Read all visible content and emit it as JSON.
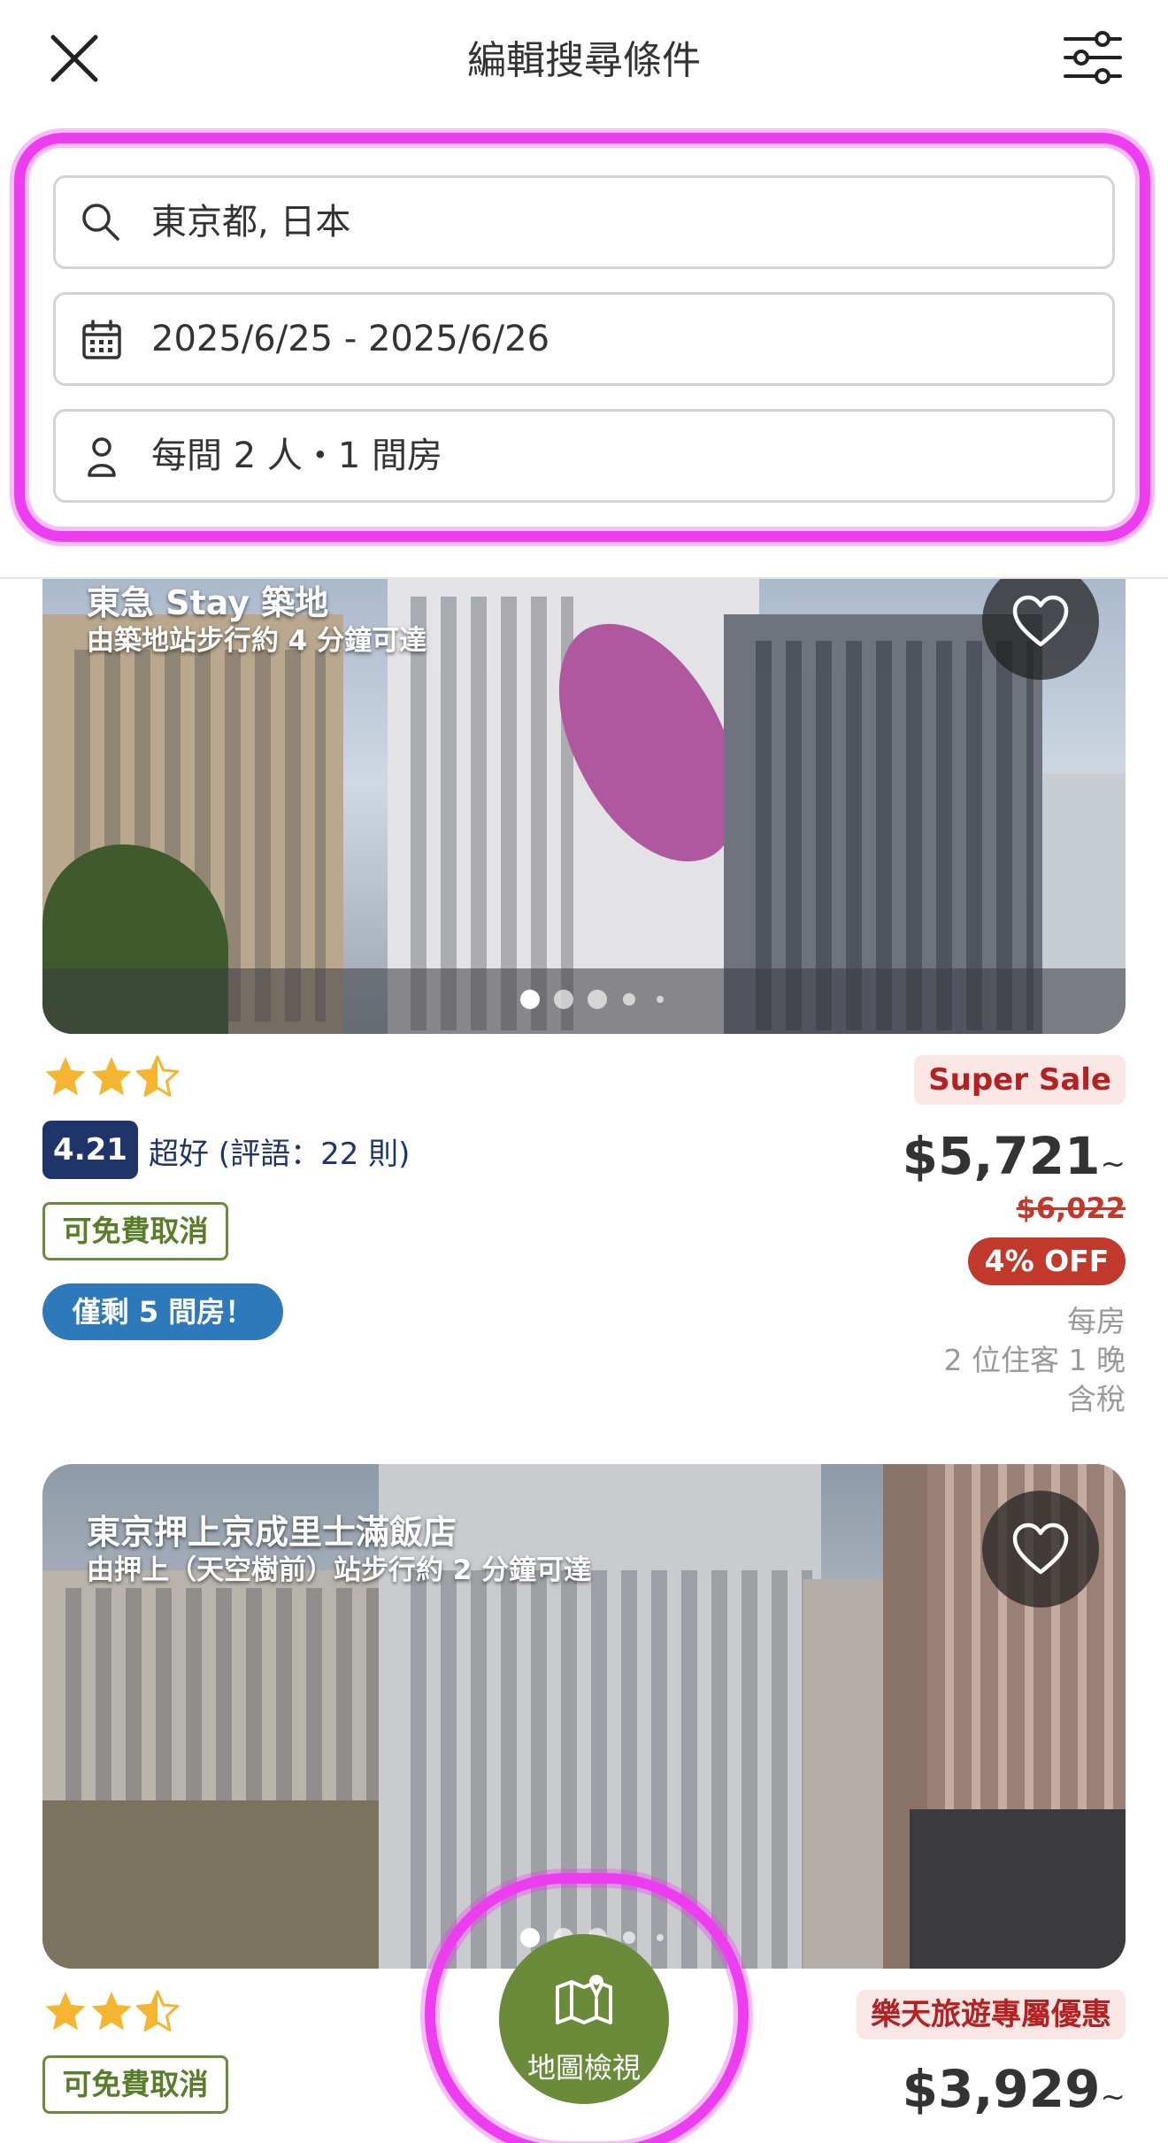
{
  "header": {
    "title": "編輯搜尋條件",
    "close_icon": "close-icon",
    "filter_icon": "sliders-icon"
  },
  "search": {
    "destination": "東京都, 日本",
    "dates": "2025/6/25 - 2025/6/26",
    "guests": "每間 2 人・1 間房"
  },
  "colors": {
    "highlight": "#ee3cf0",
    "rating_badge": "#1f3468",
    "cancel_green": "#6a8c3a",
    "rooms_blue": "#2e79b9",
    "sale_red": "#c0392b"
  },
  "hotels": [
    {
      "name": "東急 Stay 築地",
      "access": "由築地站步行約 4 分鐘可達",
      "stars": 3.5,
      "rating_score": "4.21",
      "rating_text": "超好 (評語：22 則)",
      "cancel_tag": "可免費取消",
      "rooms_left": "僅剩 5 間房！",
      "sale_tag": "Super Sale",
      "price": "$5,721",
      "price_suffix": "~",
      "old_price": "$6,022",
      "discount": "4% OFF",
      "note_line1": "每房",
      "note_line2": "2 位住客 1 晚",
      "note_line3": "含稅",
      "photo_index": 1,
      "photo_count": 5
    },
    {
      "name": "東京押上京成里士滿飯店",
      "access": "由押上（天空樹前）站步行約 2 分鐘可達",
      "stars": 3.5,
      "cancel_tag": "可免費取消",
      "sale_tag": "樂天旅遊專屬優惠",
      "price": "$3,929",
      "price_suffix": "~",
      "photo_index": 1,
      "photo_count": 5
    }
  ],
  "map_button": {
    "label": "地圖檢視",
    "icon": "map-pin-icon"
  }
}
